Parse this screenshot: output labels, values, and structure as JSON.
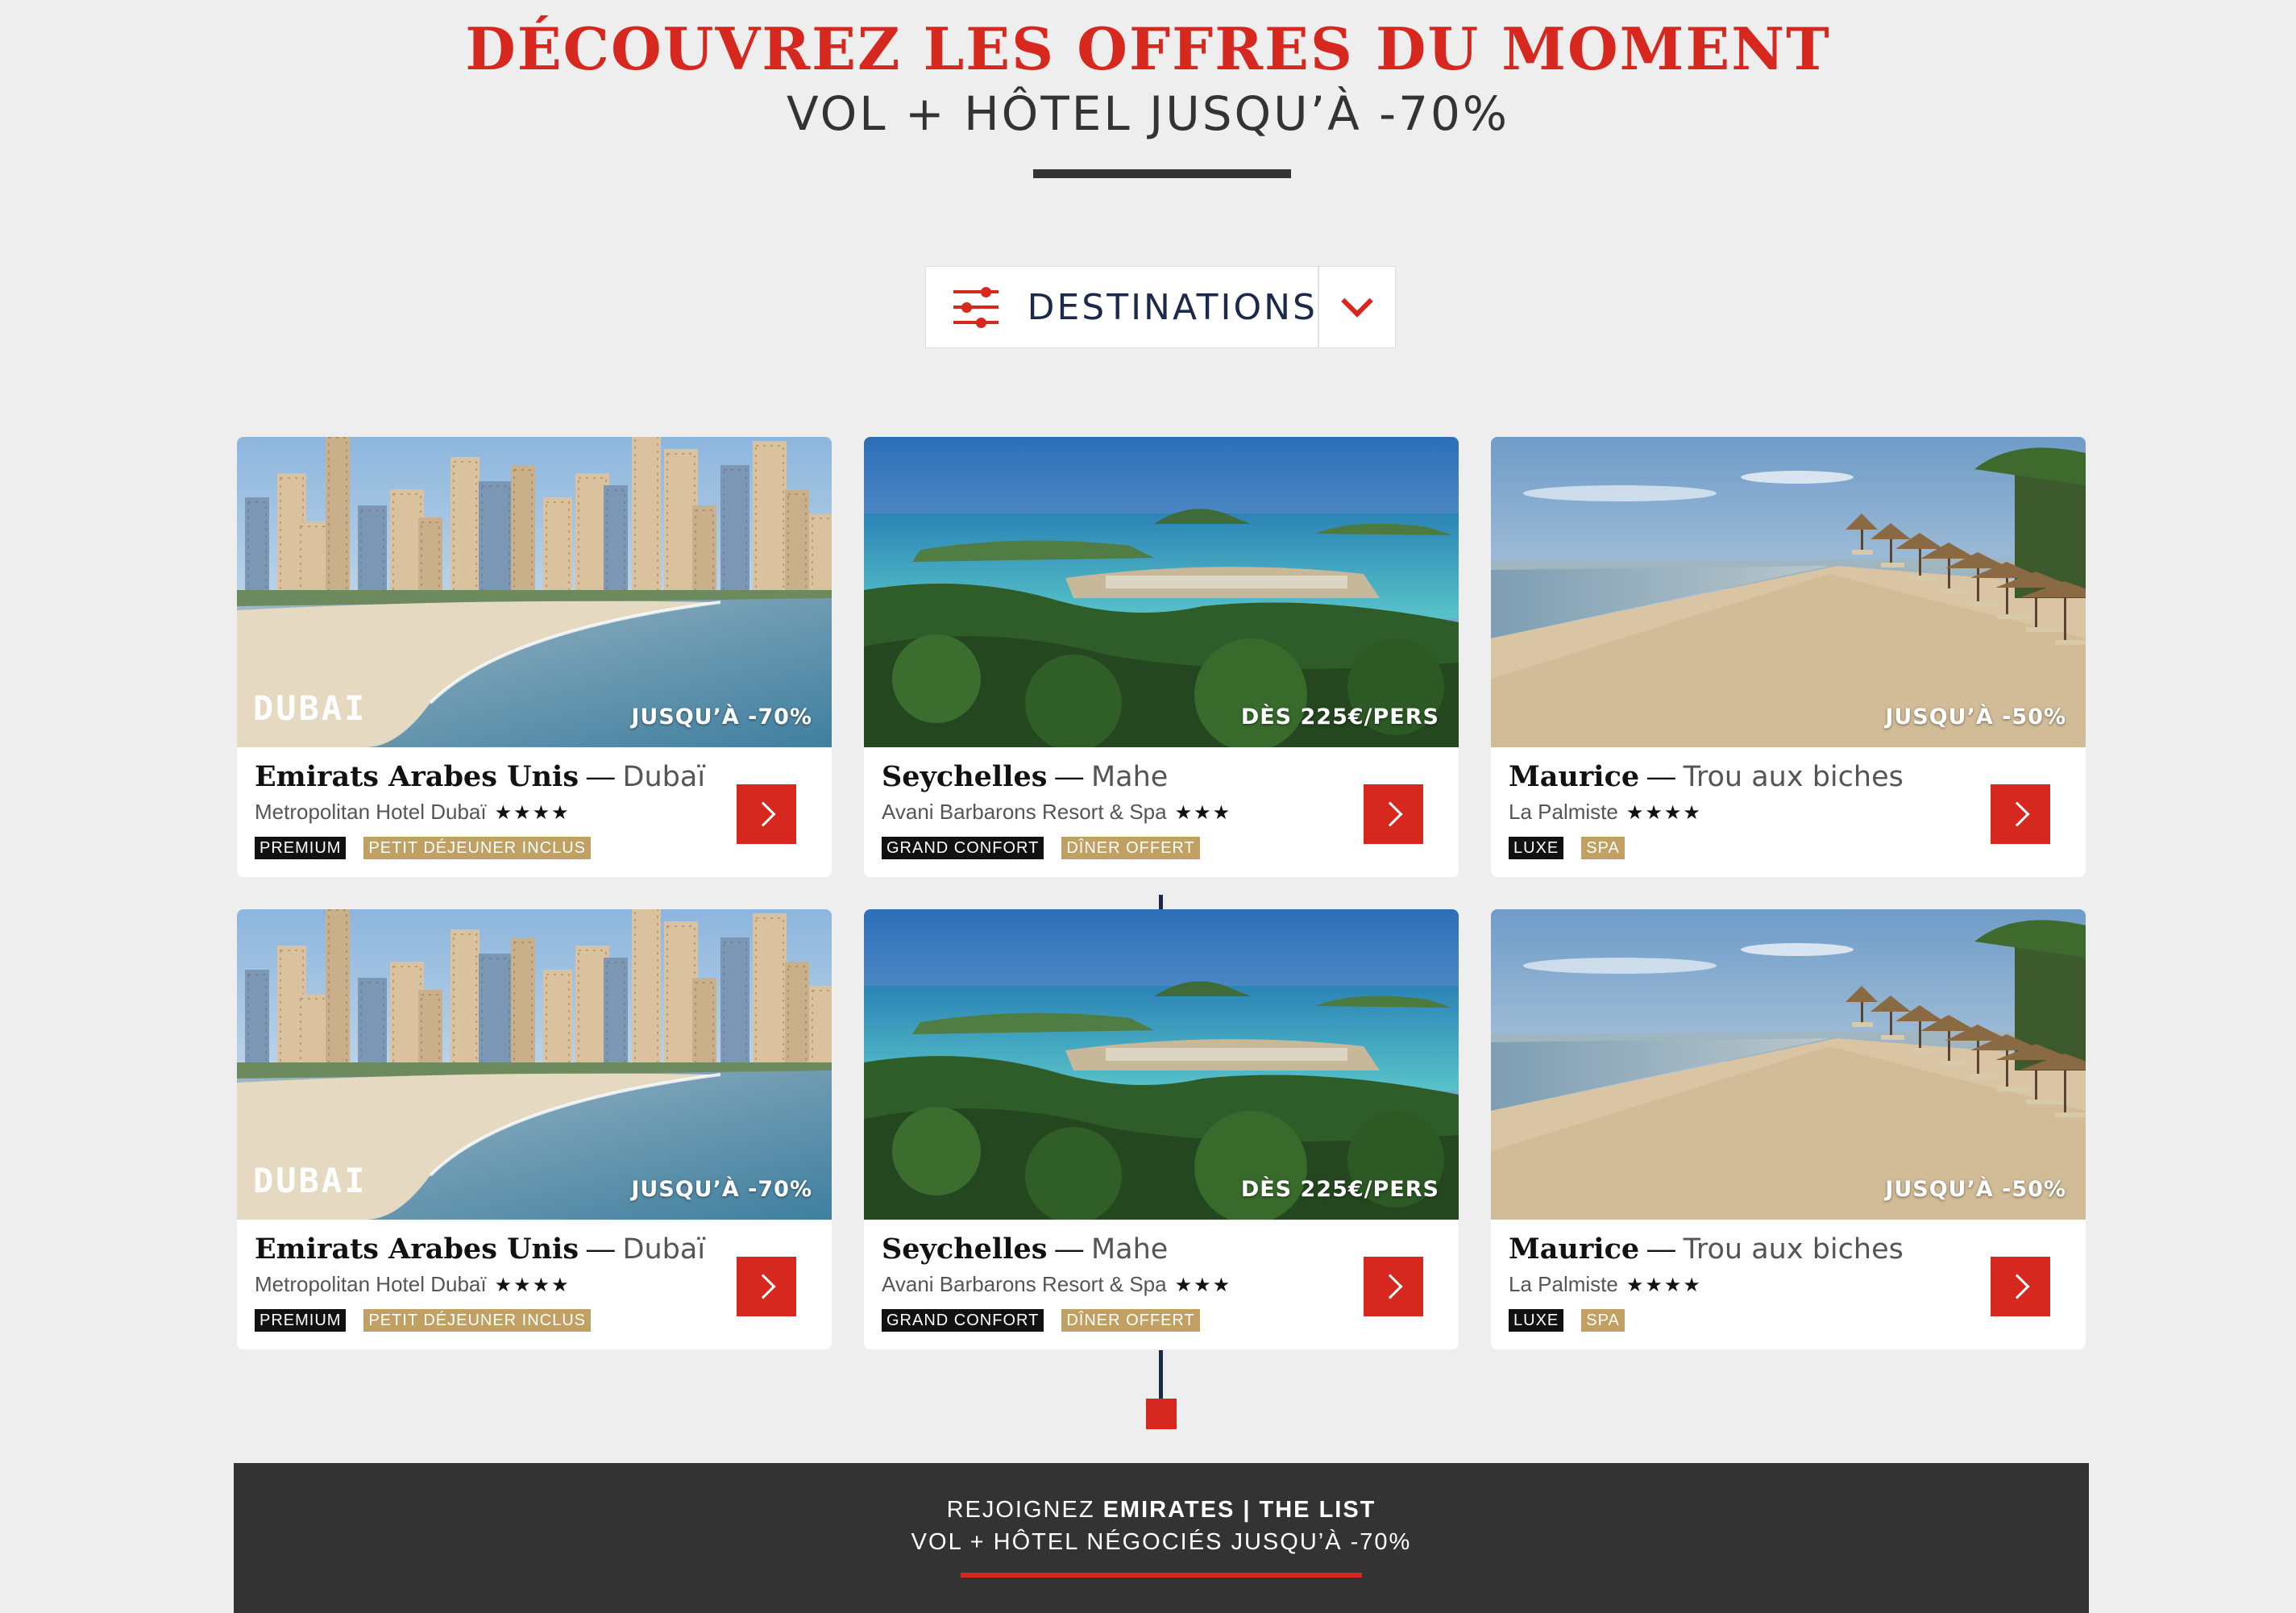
{
  "header": {
    "title": "DÉCOUVREZ LES OFFRES DU MOMENT",
    "subtitle": "VOL + HÔTEL JUSQU’À -70%"
  },
  "filter": {
    "label": "DESTINATIONS",
    "icon": "sliders-icon",
    "toggle_icon": "chevron-down-icon"
  },
  "offers": [
    {
      "country": "Emirats Arabes Unis",
      "separator": "—",
      "city": "Dubaï",
      "hotel": "Metropolitan Hotel Dubaï",
      "stars": "★★★★",
      "tags": [
        "PREMIUM",
        "PETIT DÉJEUNER INCLUS"
      ],
      "badge": "JUSQU’À -70%",
      "logo": "DUBAI",
      "image": "dubai-marina-beach"
    },
    {
      "country": "Seychelles",
      "separator": "—",
      "city": "Mahe",
      "hotel": "Avani Barbarons Resort & Spa",
      "stars": "★★★",
      "tags": [
        "GRAND CONFORT",
        "DÎNER OFFERT"
      ],
      "badge": "DÈS 225€/PERS",
      "image": "seychelles-island-view"
    },
    {
      "country": "Maurice",
      "separator": "—",
      "city": "Trou aux biches",
      "hotel": "La Palmiste",
      "stars": "★★★★",
      "tags": [
        "LUXE",
        "SPA"
      ],
      "badge": "JUSQU’À -50%",
      "image": "mauritius-beach-parasols"
    }
  ],
  "footer": {
    "line1_prefix": "REJOIGNEZ ",
    "line1_brand": "EMIRATES | THE LIST",
    "line2": "VOL + HÔTEL NÉGOCIÉS JUSQU’À -70%"
  },
  "colors": {
    "accent": "#d6281f",
    "navy": "#1b2a4a",
    "gold_tag": "#c0a063",
    "footer_bg": "#333333",
    "page_bg": "#eeeeee"
  }
}
